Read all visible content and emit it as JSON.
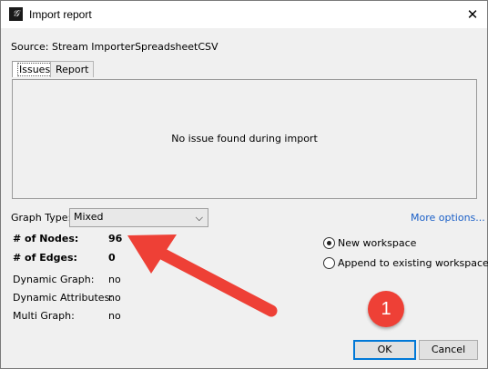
{
  "window": {
    "title": "Import report",
    "close_glyph": "✕",
    "app_icon_glyph": "𝒢"
  },
  "source_line": "Source:  Stream ImporterSpreadsheetCSV",
  "tabs": [
    {
      "label": "Issues",
      "selected": true
    },
    {
      "label": "Report",
      "selected": false
    }
  ],
  "panel": {
    "message": "No issue found during import"
  },
  "graph_type": {
    "label": "Graph Type:",
    "value": "Mixed",
    "chevron": "⌵"
  },
  "more_options": "More options...",
  "stats": [
    {
      "label": "# of Nodes:",
      "value": "96"
    },
    {
      "label": "# of Edges:",
      "value": "0"
    },
    {
      "label": "Dynamic Graph:",
      "value": "no"
    },
    {
      "label": "Dynamic Attributes:",
      "value": "no"
    },
    {
      "label": "Multi Graph:",
      "value": "no"
    }
  ],
  "workspace_options": [
    {
      "label": "New workspace",
      "selected": true
    },
    {
      "label": "Append to existing workspace",
      "selected": false
    }
  ],
  "buttons": {
    "ok": "OK",
    "cancel": "Cancel"
  },
  "annotation": {
    "badge_number": "1",
    "color": "#ee4036"
  }
}
